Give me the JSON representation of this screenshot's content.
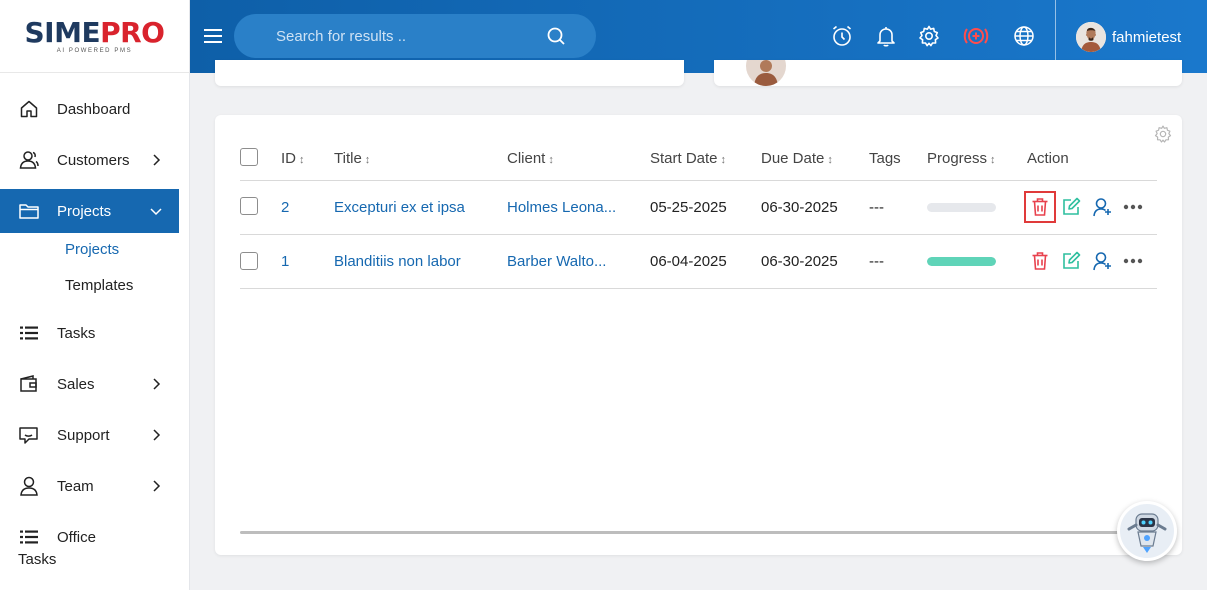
{
  "brand": {
    "name_part1": "SIME",
    "name_part2": "PRO",
    "tagline": "AI POWERED PMS"
  },
  "search": {
    "placeholder": "Search for results .."
  },
  "user": {
    "name": "fahmietest"
  },
  "sidebar": {
    "items": [
      {
        "label": "Dashboard",
        "icon": "home-icon"
      },
      {
        "label": "Customers",
        "icon": "customers-icon",
        "has_children": true
      },
      {
        "label": "Projects",
        "icon": "folder-icon",
        "active": true,
        "expanded": true
      },
      {
        "label": "Tasks",
        "icon": "list-icon"
      },
      {
        "label": "Sales",
        "icon": "wallet-icon",
        "has_children": true
      },
      {
        "label": "Support",
        "icon": "chat-icon",
        "has_children": true
      },
      {
        "label": "Team",
        "icon": "user-icon",
        "has_children": true
      },
      {
        "label": "Office Tasks",
        "icon": "list-icon"
      }
    ],
    "sub_items": [
      {
        "label": "Projects",
        "current": true
      },
      {
        "label": "Templates"
      }
    ]
  },
  "table": {
    "columns": [
      "ID",
      "Title",
      "Client",
      "Start Date",
      "Due Date",
      "Tags",
      "Progress",
      "Action"
    ],
    "sort_glyph": "↕",
    "rows": [
      {
        "id": "2",
        "title": "Excepturi ex et ipsa",
        "client": "Holmes Leona...",
        "start_date": "05-25-2025",
        "due_date": "06-30-2025",
        "tags": "---",
        "progress": 0
      },
      {
        "id": "1",
        "title": "Blanditiis non labor",
        "client": "Barber Walto...",
        "start_date": "06-04-2025",
        "due_date": "06-30-2025",
        "tags": "---",
        "progress": 100
      }
    ]
  },
  "colors": {
    "primary": "#1668b0",
    "header_start": "#0e5fa8",
    "header_end": "#1a78cc",
    "delete": "#e8414d",
    "edit": "#2fbf9f",
    "progress": "#5fd4b8"
  }
}
